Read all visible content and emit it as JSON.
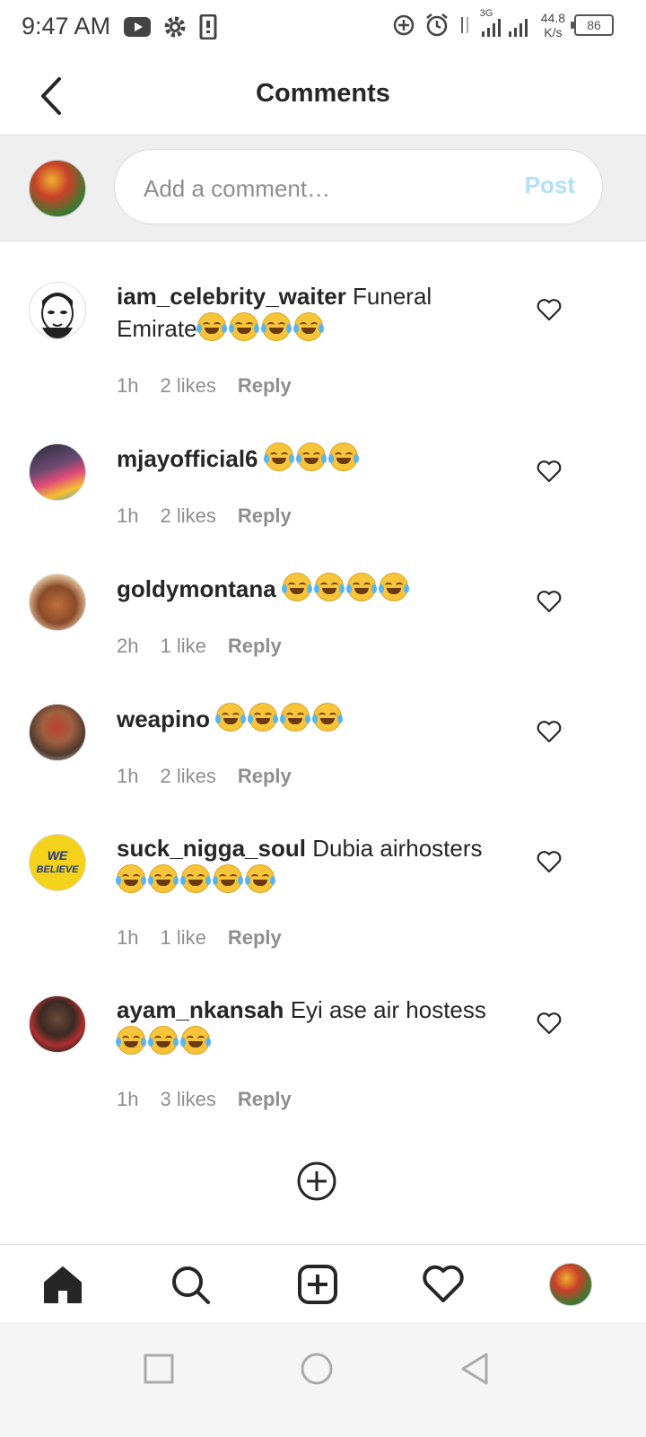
{
  "status_bar": {
    "time": "9:47 AM",
    "network": "3G",
    "speed_value": "44.8",
    "speed_unit": "K/s",
    "battery": "86"
  },
  "header": {
    "title": "Comments"
  },
  "composer": {
    "placeholder": "Add a comment…",
    "post_label": "Post",
    "post_color": "#b2dffc"
  },
  "comments": [
    {
      "username": "iam_celebrity_waiter",
      "text": "Funeral Emirate",
      "emoji_count": 4,
      "time": "1h",
      "likes": "2 likes",
      "reply": "Reply"
    },
    {
      "username": "mjayofficial6",
      "text": "",
      "emoji_count": 3,
      "time": "1h",
      "likes": "2 likes",
      "reply": "Reply"
    },
    {
      "username": "goldymontana",
      "text": "",
      "emoji_count": 4,
      "time": "2h",
      "likes": "1 like",
      "reply": "Reply"
    },
    {
      "username": "weapino",
      "text": "",
      "emoji_count": 4,
      "time": "1h",
      "likes": "2 likes",
      "reply": "Reply"
    },
    {
      "username": "suck_nigga_soul",
      "text": "Dubia airhosters",
      "emoji_count": 5,
      "time": "1h",
      "likes": "1 like",
      "reply": "Reply"
    },
    {
      "username": "ayam_nkansah",
      "text": "Eyi ase air hostess",
      "emoji_count": 3,
      "time": "1h",
      "likes": "3 likes",
      "reply": "Reply"
    }
  ],
  "avatar_badge_text": "WE BELIEVE",
  "emoji_name": "face-with-tears-of-joy",
  "bottom_nav": [
    "home-icon",
    "search-icon",
    "new-post-icon",
    "activity-heart-icon",
    "profile-avatar"
  ],
  "system_nav": [
    "recents-square-icon",
    "home-circle-icon",
    "back-triangle-icon"
  ]
}
